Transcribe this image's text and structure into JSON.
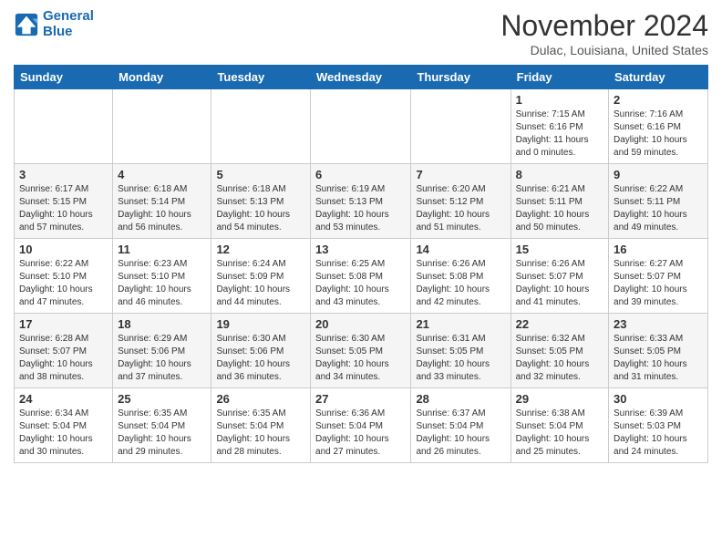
{
  "header": {
    "logo_line1": "General",
    "logo_line2": "Blue",
    "month_title": "November 2024",
    "location": "Dulac, Louisiana, United States"
  },
  "days_of_week": [
    "Sunday",
    "Monday",
    "Tuesday",
    "Wednesday",
    "Thursday",
    "Friday",
    "Saturday"
  ],
  "weeks": [
    [
      {
        "day": "",
        "info": ""
      },
      {
        "day": "",
        "info": ""
      },
      {
        "day": "",
        "info": ""
      },
      {
        "day": "",
        "info": ""
      },
      {
        "day": "",
        "info": ""
      },
      {
        "day": "1",
        "info": "Sunrise: 7:15 AM\nSunset: 6:16 PM\nDaylight: 11 hours\nand 0 minutes."
      },
      {
        "day": "2",
        "info": "Sunrise: 7:16 AM\nSunset: 6:16 PM\nDaylight: 10 hours\nand 59 minutes."
      }
    ],
    [
      {
        "day": "3",
        "info": "Sunrise: 6:17 AM\nSunset: 5:15 PM\nDaylight: 10 hours\nand 57 minutes."
      },
      {
        "day": "4",
        "info": "Sunrise: 6:18 AM\nSunset: 5:14 PM\nDaylight: 10 hours\nand 56 minutes."
      },
      {
        "day": "5",
        "info": "Sunrise: 6:18 AM\nSunset: 5:13 PM\nDaylight: 10 hours\nand 54 minutes."
      },
      {
        "day": "6",
        "info": "Sunrise: 6:19 AM\nSunset: 5:13 PM\nDaylight: 10 hours\nand 53 minutes."
      },
      {
        "day": "7",
        "info": "Sunrise: 6:20 AM\nSunset: 5:12 PM\nDaylight: 10 hours\nand 51 minutes."
      },
      {
        "day": "8",
        "info": "Sunrise: 6:21 AM\nSunset: 5:11 PM\nDaylight: 10 hours\nand 50 minutes."
      },
      {
        "day": "9",
        "info": "Sunrise: 6:22 AM\nSunset: 5:11 PM\nDaylight: 10 hours\nand 49 minutes."
      }
    ],
    [
      {
        "day": "10",
        "info": "Sunrise: 6:22 AM\nSunset: 5:10 PM\nDaylight: 10 hours\nand 47 minutes."
      },
      {
        "day": "11",
        "info": "Sunrise: 6:23 AM\nSunset: 5:10 PM\nDaylight: 10 hours\nand 46 minutes."
      },
      {
        "day": "12",
        "info": "Sunrise: 6:24 AM\nSunset: 5:09 PM\nDaylight: 10 hours\nand 44 minutes."
      },
      {
        "day": "13",
        "info": "Sunrise: 6:25 AM\nSunset: 5:08 PM\nDaylight: 10 hours\nand 43 minutes."
      },
      {
        "day": "14",
        "info": "Sunrise: 6:26 AM\nSunset: 5:08 PM\nDaylight: 10 hours\nand 42 minutes."
      },
      {
        "day": "15",
        "info": "Sunrise: 6:26 AM\nSunset: 5:07 PM\nDaylight: 10 hours\nand 41 minutes."
      },
      {
        "day": "16",
        "info": "Sunrise: 6:27 AM\nSunset: 5:07 PM\nDaylight: 10 hours\nand 39 minutes."
      }
    ],
    [
      {
        "day": "17",
        "info": "Sunrise: 6:28 AM\nSunset: 5:07 PM\nDaylight: 10 hours\nand 38 minutes."
      },
      {
        "day": "18",
        "info": "Sunrise: 6:29 AM\nSunset: 5:06 PM\nDaylight: 10 hours\nand 37 minutes."
      },
      {
        "day": "19",
        "info": "Sunrise: 6:30 AM\nSunset: 5:06 PM\nDaylight: 10 hours\nand 36 minutes."
      },
      {
        "day": "20",
        "info": "Sunrise: 6:30 AM\nSunset: 5:05 PM\nDaylight: 10 hours\nand 34 minutes."
      },
      {
        "day": "21",
        "info": "Sunrise: 6:31 AM\nSunset: 5:05 PM\nDaylight: 10 hours\nand 33 minutes."
      },
      {
        "day": "22",
        "info": "Sunrise: 6:32 AM\nSunset: 5:05 PM\nDaylight: 10 hours\nand 32 minutes."
      },
      {
        "day": "23",
        "info": "Sunrise: 6:33 AM\nSunset: 5:05 PM\nDaylight: 10 hours\nand 31 minutes."
      }
    ],
    [
      {
        "day": "24",
        "info": "Sunrise: 6:34 AM\nSunset: 5:04 PM\nDaylight: 10 hours\nand 30 minutes."
      },
      {
        "day": "25",
        "info": "Sunrise: 6:35 AM\nSunset: 5:04 PM\nDaylight: 10 hours\nand 29 minutes."
      },
      {
        "day": "26",
        "info": "Sunrise: 6:35 AM\nSunset: 5:04 PM\nDaylight: 10 hours\nand 28 minutes."
      },
      {
        "day": "27",
        "info": "Sunrise: 6:36 AM\nSunset: 5:04 PM\nDaylight: 10 hours\nand 27 minutes."
      },
      {
        "day": "28",
        "info": "Sunrise: 6:37 AM\nSunset: 5:04 PM\nDaylight: 10 hours\nand 26 minutes."
      },
      {
        "day": "29",
        "info": "Sunrise: 6:38 AM\nSunset: 5:04 PM\nDaylight: 10 hours\nand 25 minutes."
      },
      {
        "day": "30",
        "info": "Sunrise: 6:39 AM\nSunset: 5:03 PM\nDaylight: 10 hours\nand 24 minutes."
      }
    ]
  ]
}
